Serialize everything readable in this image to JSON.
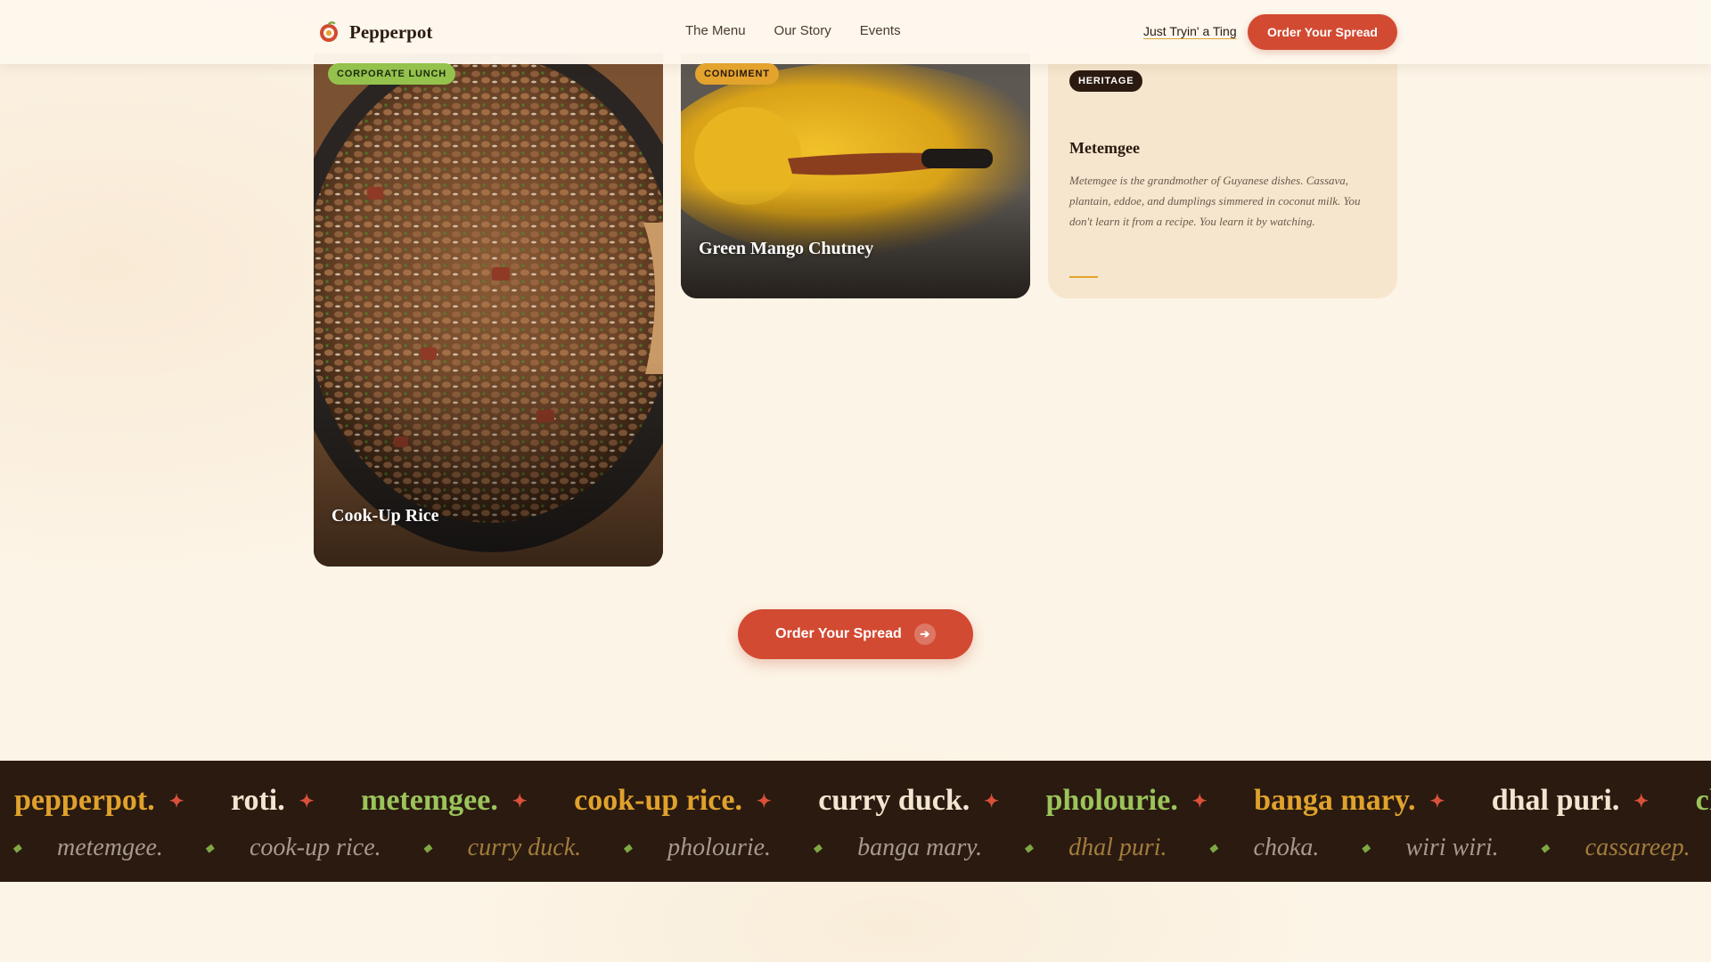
{
  "header": {
    "logo_text": "Pepperpot",
    "nav": [
      "The Menu",
      "Our Story",
      "Events"
    ],
    "secondary_link": "Just Tryin' a Ting",
    "cta": "Order Your Spread"
  },
  "cards": {
    "rice": {
      "tag": "CORPORATE LUNCH",
      "title": "Cook-Up Rice"
    },
    "chutney": {
      "tag": "CONDIMENT",
      "title": "Green Mango Chutney"
    },
    "heritage": {
      "tag": "HERITAGE",
      "title": "Metemgee",
      "text": "Metemgee is the grandmother of Guyanese dishes. Cassava, plantain, eddoe, and dumplings simmered in coconut milk. You don't learn it from a recipe. You learn it by watching."
    }
  },
  "main_cta": {
    "label": "Order Your Spread",
    "icon": "arrow-right-icon"
  },
  "marquee": {
    "row1": [
      "pepperpot.",
      "roti.",
      "metemgee.",
      "cook-up rice.",
      "curry duck.",
      "pholourie.",
      "banga mary.",
      "dhal puri.",
      "choka."
    ],
    "row2": [
      "metemgee.",
      "cook-up rice.",
      "curry duck.",
      "pholourie.",
      "banga mary.",
      "dhal puri.",
      "choka.",
      "wiri wiri.",
      "cassareep."
    ]
  },
  "colors": {
    "accent": "#d24a32",
    "gold": "#e3a32d",
    "green": "#94c24d",
    "dark": "#2a1a10",
    "background": "#fcf4e6"
  }
}
